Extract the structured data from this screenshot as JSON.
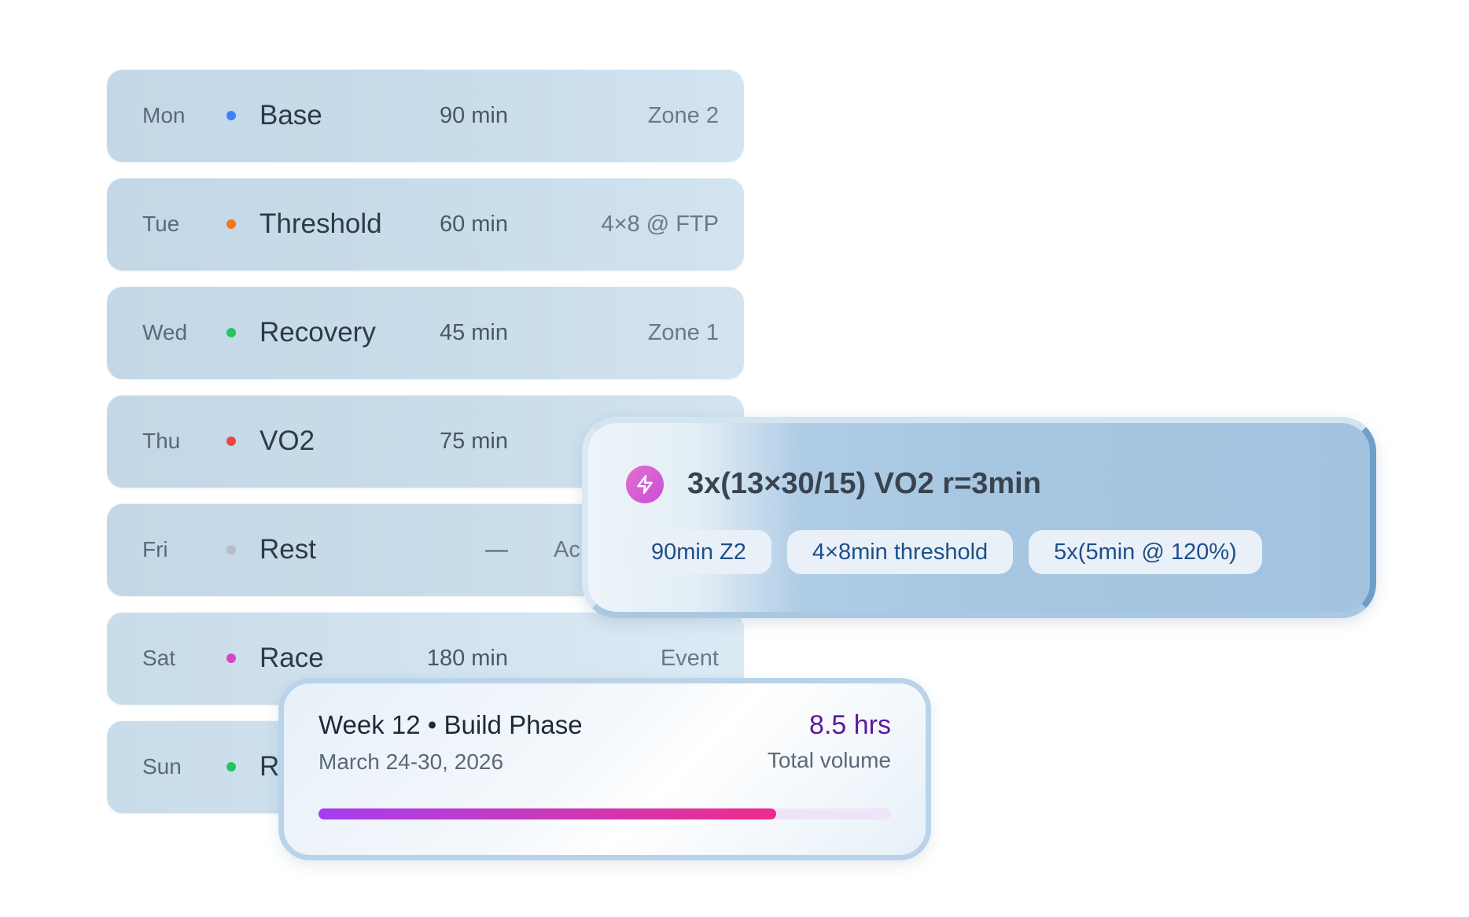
{
  "days": [
    {
      "day": "Mon",
      "dot_color": "#3b82f6",
      "name": "Base",
      "duration": "90 min",
      "detail": "Zone 2"
    },
    {
      "day": "Tue",
      "dot_color": "#f97316",
      "name": "Threshold",
      "duration": "60 min",
      "detail": "4×8 @ FTP"
    },
    {
      "day": "Wed",
      "dot_color": "#22c55e",
      "name": "Recovery",
      "duration": "45 min",
      "detail": "Zone 1"
    },
    {
      "day": "Thu",
      "dot_color": "#ef4444",
      "name": "VO2",
      "duration": "75 min",
      "detail": ""
    },
    {
      "day": "Fri",
      "dot_color": "#b8bec6",
      "name": "Rest",
      "duration": "—",
      "detail": "Ac"
    },
    {
      "day": "Sat",
      "dot_color": "#d946c4",
      "name": "Race",
      "duration": "180 min",
      "detail": "Event"
    },
    {
      "day": "Sun",
      "dot_color": "#22c55e",
      "name": "R",
      "duration": "",
      "detail": ""
    }
  ],
  "workout_card": {
    "icon": "lightning-icon",
    "title": "3x(13×30/15) VO2 r=3min",
    "chips": [
      "90min Z2",
      "4×8min threshold",
      "5x(5min @ 120%)"
    ]
  },
  "week_card": {
    "title": "Week 12 • Build Phase",
    "dates": "March 24-30, 2026",
    "hours": "8.5 hrs",
    "volume_label": "Total volume",
    "progress": 0.8,
    "accent_color": "#5b1a9a"
  }
}
